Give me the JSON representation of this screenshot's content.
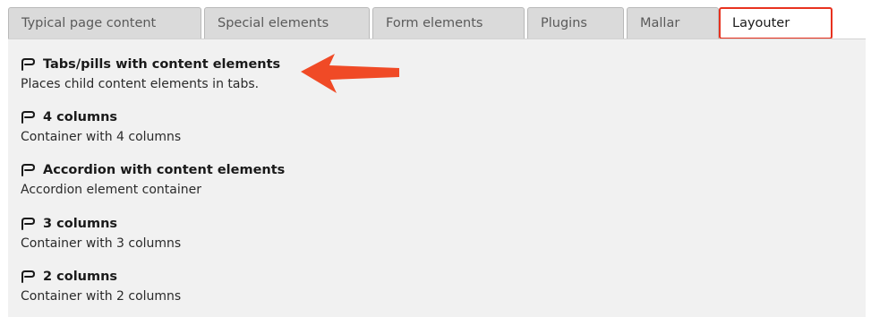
{
  "tabs": [
    {
      "label": "Typical page content"
    },
    {
      "label": "Special elements"
    },
    {
      "label": "Form elements"
    },
    {
      "label": "Plugins"
    },
    {
      "label": "Mallar"
    },
    {
      "label": "Layouter"
    }
  ],
  "active_tab": "Layouter",
  "items": [
    {
      "title": "Tabs/pills with content elements",
      "description": "Places child content elements in tabs.",
      "icon": "layout-element-icon"
    },
    {
      "title": "4 columns",
      "description": "Container with 4 columns",
      "icon": "layout-element-icon"
    },
    {
      "title": "Accordion with content elements",
      "description": "Accordion element container",
      "icon": "layout-element-icon"
    },
    {
      "title": "3 columns",
      "description": "Container with 3 columns",
      "icon": "layout-element-icon"
    },
    {
      "title": "2 columns",
      "description": "Container with 2 columns",
      "icon": "layout-element-icon"
    }
  ],
  "colors": {
    "highlight": "#e8321f",
    "arrow": "#f04a26",
    "tab_inactive": "#dadada",
    "panel": "#f1f1f1"
  }
}
